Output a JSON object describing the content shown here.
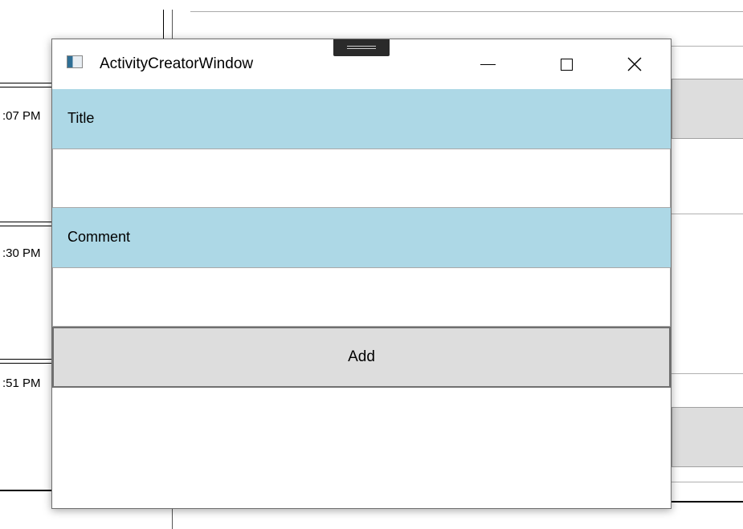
{
  "background": {
    "times": [
      ":07 PM",
      ":30 PM",
      ":51 PM"
    ]
  },
  "window": {
    "title": "ActivityCreatorWindow",
    "icon": "app-window-icon",
    "caption_buttons": [
      "minimize-icon",
      "maximize-icon",
      "close-icon"
    ],
    "close_glyph": "✕"
  },
  "form": {
    "title_label": "Title",
    "title_value": "",
    "comment_label": "Comment",
    "comment_value": "",
    "add_label": "Add"
  },
  "colors": {
    "label_band": "#add8e6",
    "button_bg": "#dddddd",
    "window_bg": "#ffffff"
  }
}
